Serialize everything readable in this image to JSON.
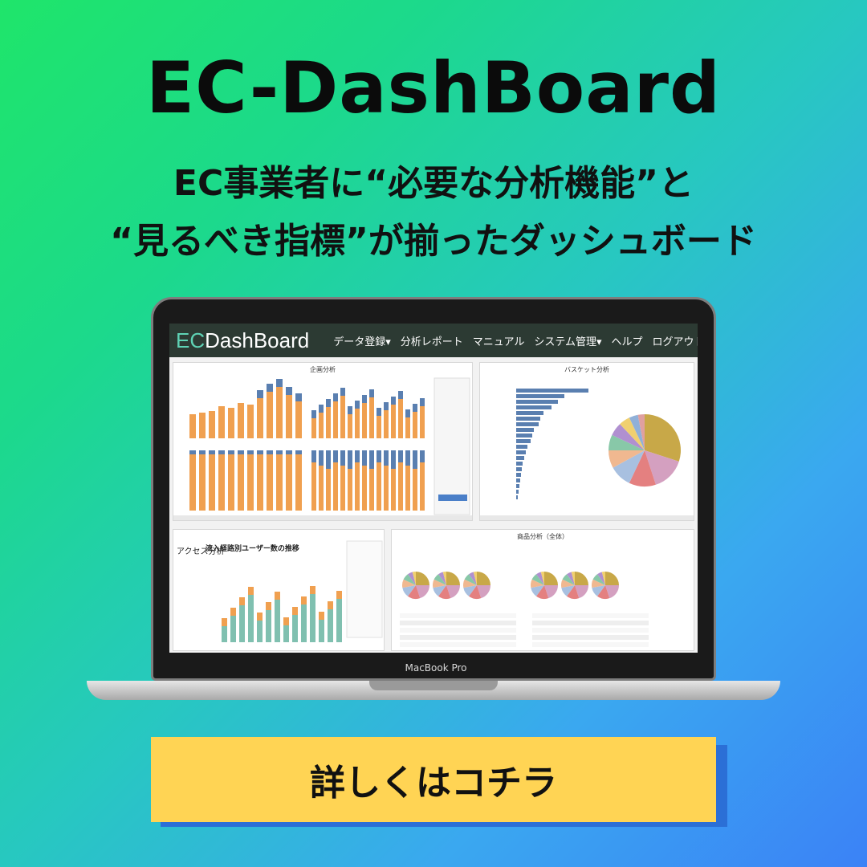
{
  "headline": "EC-DashBoard",
  "subtitle_line1": "EC事業者に“必要な分析機能”と",
  "subtitle_line2": "“見るべき指標”が揃ったダッシュボード",
  "app": {
    "logo_ec": "EC",
    "logo_rest": "DashBoard",
    "nav": [
      "データ登録▾",
      "分析レポート",
      "マニュアル",
      "システム管理▾",
      "ヘルプ",
      "ログアウト"
    ]
  },
  "panels": {
    "plan": "企画分析",
    "basket": "バスケット分析",
    "access": "アクセス分析",
    "access_chart": "流入経路別ユーザー数の推移",
    "product": "商品分析（全体）"
  },
  "device_label": "MacBook Pro",
  "cta_label": "詳しくはコチラ",
  "colors": {
    "bar_orange": "#f0a050",
    "bar_blue": "#5a7fb0",
    "cta": "#ffd454",
    "appbar": "#2c3a33"
  }
}
